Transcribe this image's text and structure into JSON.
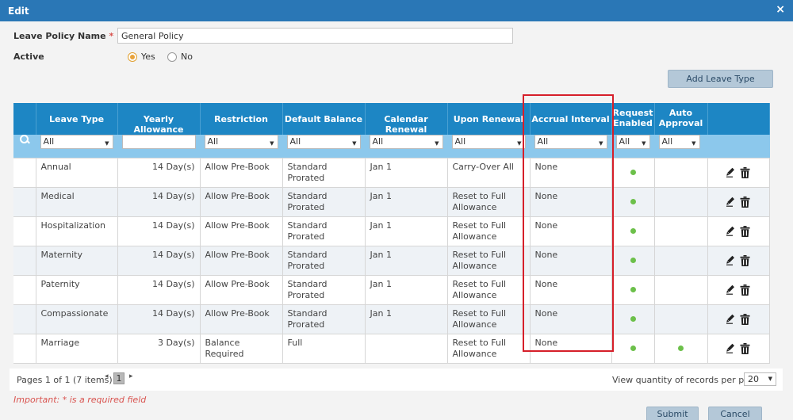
{
  "dialog": {
    "title": "Edit",
    "close_glyph": "×"
  },
  "form": {
    "name_label": "Leave Policy Name",
    "required_mark": "*",
    "name_value": "General Policy",
    "active_label": "Active",
    "yes_label": "Yes",
    "no_label": "No",
    "active_selected": "Yes"
  },
  "toolbar": {
    "add_label": "Add Leave Type"
  },
  "grid": {
    "columns": [
      "Leave Type",
      "Yearly Allowance",
      "Restriction",
      "Default Balance",
      "Calendar Renewal",
      "Upon Renewal",
      "Accrual Interval",
      "Request Enabled",
      "Auto Approval"
    ],
    "filters": [
      "All",
      "",
      "All",
      "All",
      "All",
      "All",
      "All",
      "All",
      "All"
    ],
    "rows": [
      {
        "type": "Annual",
        "allowance": "14 Day(s)",
        "restriction": "Allow Pre-Book",
        "balance": "Standard Prorated",
        "renewal": "Jan 1",
        "upon": "Carry-Over All",
        "accrual": "None",
        "request": true,
        "auto": false
      },
      {
        "type": "Medical",
        "allowance": "14 Day(s)",
        "restriction": "Allow Pre-Book",
        "balance": "Standard Prorated",
        "renewal": "Jan 1",
        "upon": "Reset to Full Allowance",
        "accrual": "None",
        "request": true,
        "auto": false
      },
      {
        "type": "Hospitalization",
        "allowance": "14 Day(s)",
        "restriction": "Allow Pre-Book",
        "balance": "Standard Prorated",
        "renewal": "Jan 1",
        "upon": "Reset to Full Allowance",
        "accrual": "None",
        "request": true,
        "auto": false
      },
      {
        "type": "Maternity",
        "allowance": "14 Day(s)",
        "restriction": "Allow Pre-Book",
        "balance": "Standard Prorated",
        "renewal": "Jan 1",
        "upon": "Reset to Full Allowance",
        "accrual": "None",
        "request": true,
        "auto": false
      },
      {
        "type": "Paternity",
        "allowance": "14 Day(s)",
        "restriction": "Allow Pre-Book",
        "balance": "Standard Prorated",
        "renewal": "Jan 1",
        "upon": "Reset to Full Allowance",
        "accrual": "None",
        "request": true,
        "auto": false
      },
      {
        "type": "Compassionate",
        "allowance": "14 Day(s)",
        "restriction": "Allow Pre-Book",
        "balance": "Standard Prorated",
        "renewal": "Jan 1",
        "upon": "Reset to Full Allowance",
        "accrual": "None",
        "request": true,
        "auto": false
      },
      {
        "type": "Marriage",
        "allowance": "3 Day(s)",
        "restriction": "Balance Required",
        "balance": "Full",
        "renewal": "",
        "upon": "Reset to Full Allowance",
        "accrual": "None",
        "request": true,
        "auto": true
      }
    ]
  },
  "pager": {
    "info": "Pages 1 of 1 (7 items)",
    "prev_glyph": "◂",
    "next_glyph": "▸",
    "current_page": "1",
    "per_page_label": "View quantity of records per page",
    "per_page_value": "20"
  },
  "footer": {
    "important": "Important: * is a required field",
    "submit_label": "Submit",
    "cancel_label": "Cancel"
  },
  "colors": {
    "header": "#1d86c4",
    "titlebar": "#2a77b6",
    "filter_row": "#8cc8ec",
    "highlight": "#d61f2a",
    "dot": "#6cc04a"
  }
}
